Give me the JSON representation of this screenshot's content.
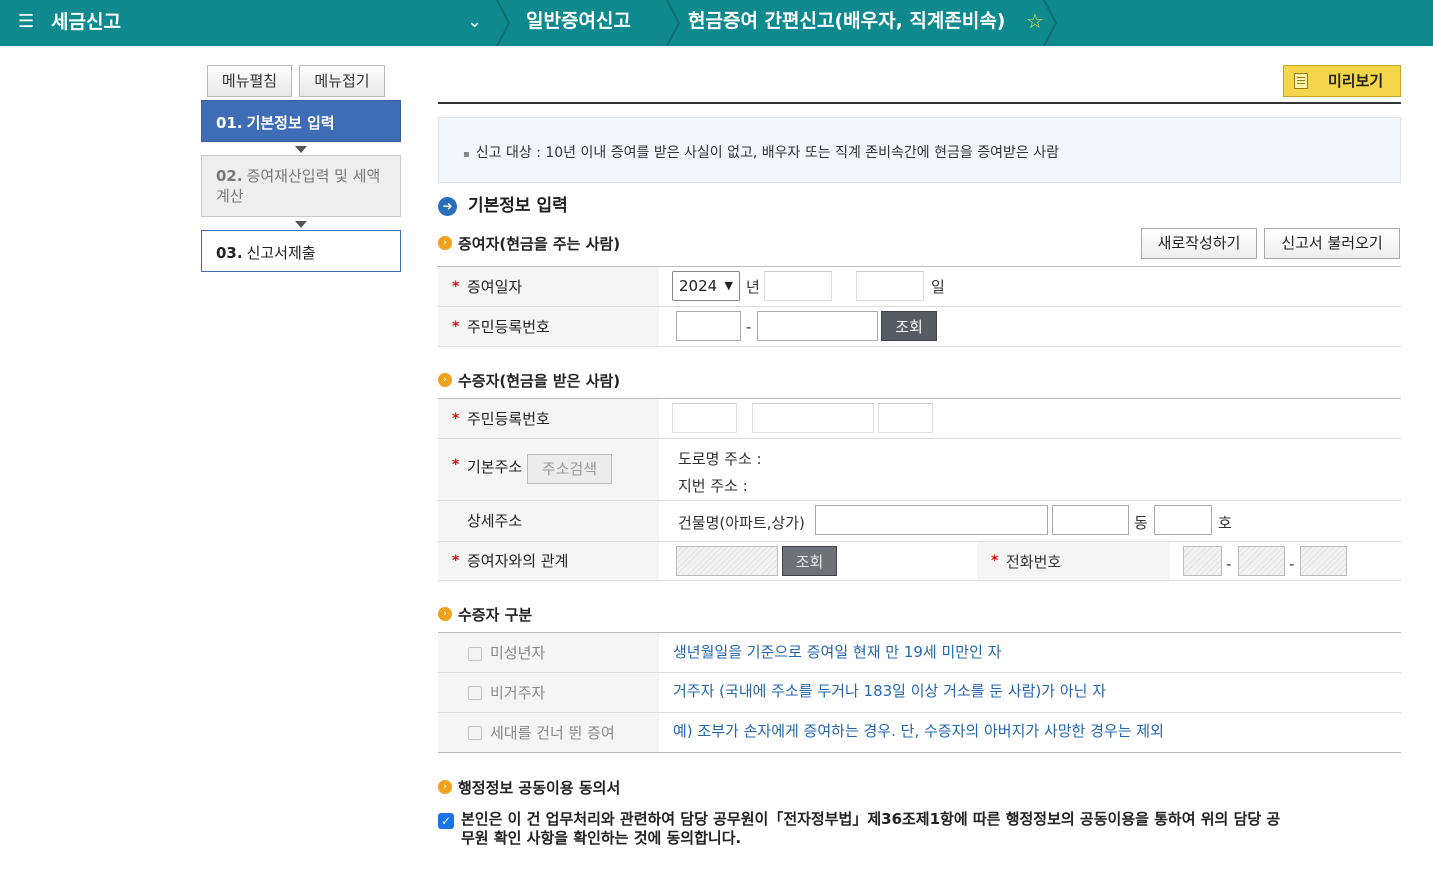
{
  "topbar": {
    "menu_icon": "hamburger-icon",
    "title": "세금신고",
    "crumbs": [
      "일반증여신고",
      "현금증여 간편신고(배우자, 직계존비속)"
    ],
    "colors": {
      "bar": "#0e8a8e",
      "star": "#f3e23a"
    }
  },
  "left_menu": {
    "expand_label": "메뉴펼침",
    "collapse_label": "메뉴접기",
    "steps": [
      {
        "num": "01.",
        "label": "기본정보 입력"
      },
      {
        "num": "02.",
        "label": "증여재산입력 및 세액계산"
      },
      {
        "num": "03.",
        "label": "신고서제출"
      }
    ]
  },
  "preview_label": "미리보기",
  "notice": "신고 대상 : 10년 이내 증여를 받은 사실이 없고, 배우자 또는 직계 존비속간에 현금을 증여받은 사람",
  "section_title": "기본정보 입력",
  "donor": {
    "heading": "증여자(현금을 주는 사람)",
    "new_button": "새로작성하기",
    "load_button": "신고서 불러오기",
    "date_label": "증여일자",
    "year_value": "2024",
    "year_unit": "년",
    "day_unit": "일",
    "rrn_label": "주민등록번호",
    "dash": "-",
    "lookup_button": "조회"
  },
  "recipient": {
    "heading": "수증자(현금을 받은 사람)",
    "rrn_label": "주민등록번호",
    "address_label": "기본주소",
    "address_search_button": "주소검색",
    "road_address_label": "도로명 주소 :",
    "lot_address_label": "지번 주소 :",
    "detail_label": "상세주소",
    "building_label": "건물명(아파트,상가)",
    "dong_unit": "동",
    "ho_unit": "호",
    "relation_label": "증여자와의 관계",
    "lookup_button": "조회",
    "phone_label": "전화번호",
    "dash": "-"
  },
  "category": {
    "heading": "수증자 구분",
    "rows": [
      {
        "label": "미성년자",
        "desc": "생년월일을 기준으로 증여일 현재 만 19세 미만인 자"
      },
      {
        "label": "비거주자",
        "desc": "거주자 (국내에 주소를 두거나 183일 이상 거소를 둔 사람)가 아닌 자"
      },
      {
        "label": "세대를 건너 뛴 증여",
        "desc": "예) 조부가 손자에게 증여하는 경우. 단, 수증자의 아버지가 사망한 경우는 제외"
      }
    ]
  },
  "consent": {
    "heading": "행정정보 공동이용 동의서",
    "text": "본인은 이 건 업무처리와 관련하여 담당 공무원이「전자정부법」제36조제1항에 따른 행정정보의 공동이용을 통하여 위의 담당 공무원 확인 사항을 확인하는 것에 동의합니다.",
    "checked": true
  }
}
